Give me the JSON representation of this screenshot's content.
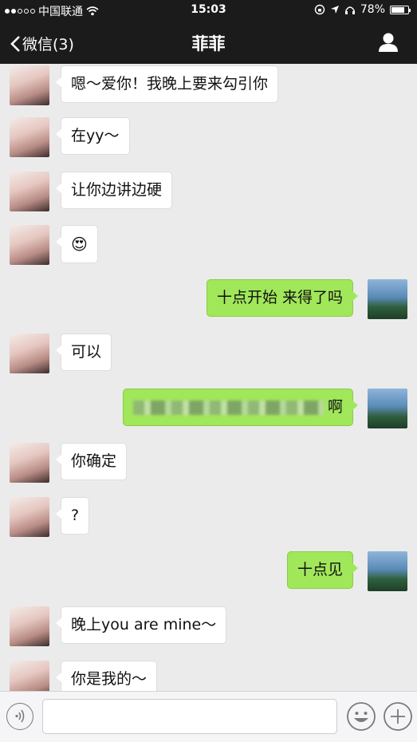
{
  "status_bar": {
    "carrier": "中国联通",
    "time": "15:03",
    "battery": "78%",
    "battery_level": 0.78
  },
  "nav": {
    "back_label": "微信(3)",
    "title": "菲菲",
    "profile_icon": "person-icon"
  },
  "messages": [
    {
      "side": "in",
      "text": "嗯～爱你！我晚上要来勾引你"
    },
    {
      "side": "in",
      "text": "在yy～"
    },
    {
      "side": "in",
      "text": "让你边讲边硬"
    },
    {
      "side": "in",
      "text": "😍"
    },
    {
      "side": "out",
      "text": "十点开始 来得了吗"
    },
    {
      "side": "in",
      "text": "可以"
    },
    {
      "side": "out",
      "text": "啊",
      "blurred": true
    },
    {
      "side": "in",
      "text": "你确定"
    },
    {
      "side": "in",
      "text": "?"
    },
    {
      "side": "out",
      "text": "十点见"
    },
    {
      "side": "in",
      "text": "晚上you are mine～"
    },
    {
      "side": "in",
      "text": "你是我的～"
    }
  ],
  "input_bar": {
    "voice_icon": "voice-icon",
    "emoji_icon": "emoji-icon",
    "plus_icon": "plus-icon"
  },
  "colors": {
    "bar_bg": "#1b1b1b",
    "chat_bg": "#ebebeb",
    "out_bubble": "#a0e75a",
    "in_bubble": "#ffffff"
  }
}
